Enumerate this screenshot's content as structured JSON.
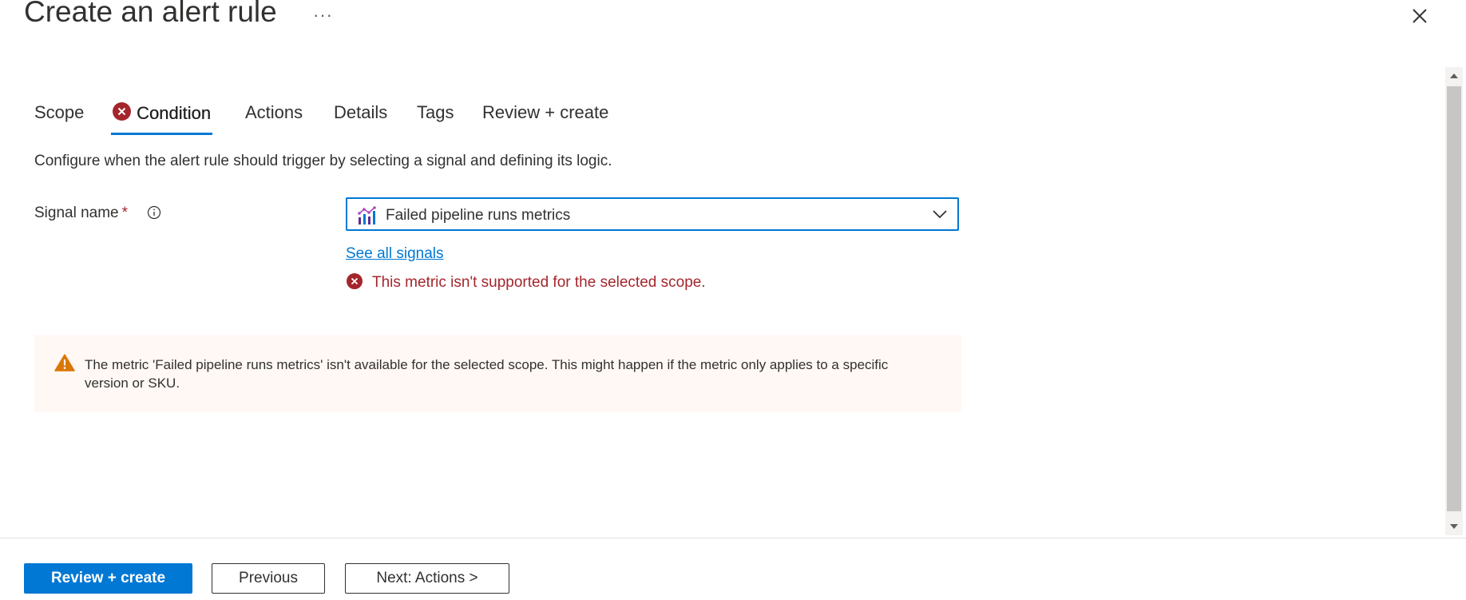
{
  "page": {
    "title": "Create an alert rule",
    "more_label": "···"
  },
  "tabs": [
    {
      "label": "Scope",
      "active": false
    },
    {
      "label": "Condition",
      "active": true,
      "has_error": true
    },
    {
      "label": "Actions",
      "active": false
    },
    {
      "label": "Details",
      "active": false
    },
    {
      "label": "Tags",
      "active": false
    },
    {
      "label": "Review + create",
      "active": false
    }
  ],
  "condition": {
    "description": "Configure when the alert rule should trigger by selecting a signal and defining its logic.",
    "signal_label": "Signal name",
    "required_mark": "*",
    "signal_value": "Failed pipeline runs metrics",
    "see_all_link": "See all signals",
    "error_message": "This metric isn't supported for the selected scope.",
    "warning_message": "The metric 'Failed pipeline runs metrics' isn't available for the selected scope. This might happen if the metric only applies to a specific version or SKU."
  },
  "footer": {
    "review_create": "Review + create",
    "previous": "Previous",
    "next": "Next: Actions >"
  },
  "colors": {
    "accent": "#0078d4",
    "error": "#a4262c",
    "warning": "#d97700",
    "warning_bg": "#fff8f4"
  },
  "icons": {
    "close": "close-icon",
    "info": "info-icon",
    "metric": "metric-chart-icon",
    "chevron": "chevron-down-icon",
    "error": "error-circle-icon",
    "warning": "warning-triangle-icon"
  }
}
